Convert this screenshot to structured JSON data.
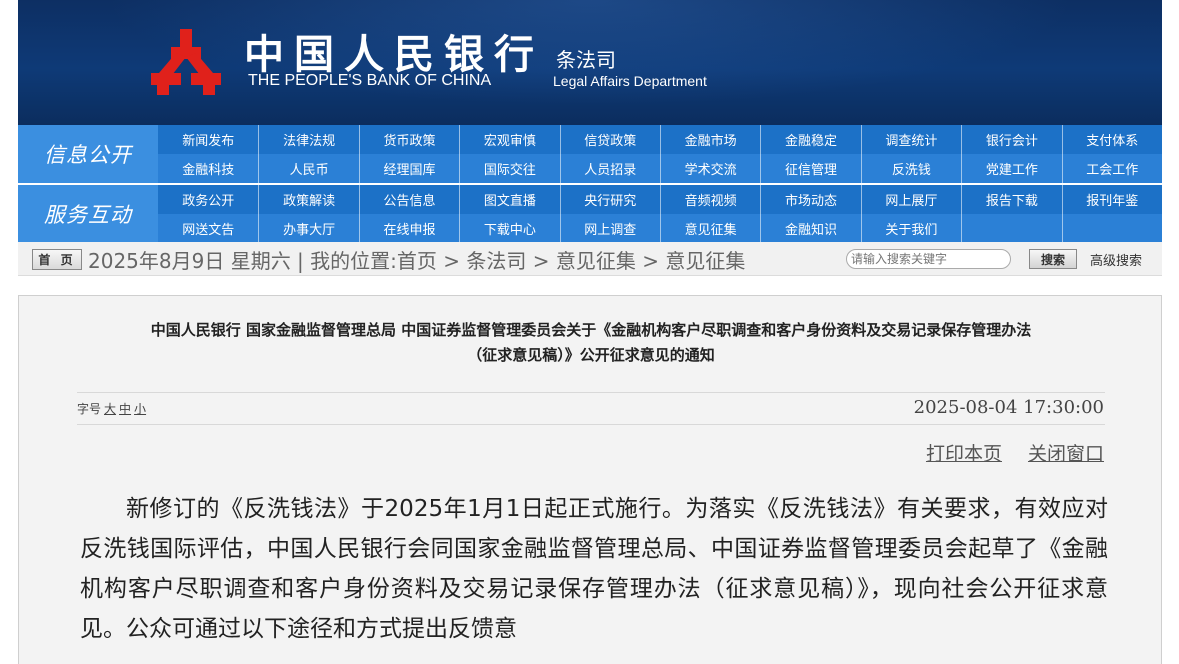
{
  "header": {
    "cn_name": "中国人民银行",
    "en_name": "THE PEOPLE'S BANK OF CHINA",
    "dept_cn": "条法司",
    "dept_en": "Legal Affairs Department",
    "logo_icon": "pboc-logo-icon",
    "logo_color": "#e0211b",
    "banner_color": "#0e3a77"
  },
  "nav": {
    "groups": [
      {
        "label": "信息公开",
        "rows": [
          [
            "新闻发布",
            "法律法规",
            "货币政策",
            "宏观审慎",
            "信贷政策",
            "金融市场",
            "金融稳定",
            "调查统计",
            "银行会计",
            "支付体系"
          ],
          [
            "金融科技",
            "人民币",
            "经理国库",
            "国际交往",
            "人员招录",
            "学术交流",
            "征信管理",
            "反洗钱",
            "党建工作",
            "工会工作"
          ]
        ]
      },
      {
        "label": "服务互动",
        "rows": [
          [
            "政务公开",
            "政策解读",
            "公告信息",
            "图文直播",
            "央行研究",
            "音频视频",
            "市场动态",
            "网上展厅",
            "报告下载",
            "报刊年鉴"
          ],
          [
            "网送文告",
            "办事大厅",
            "在线申报",
            "下载中心",
            "网上调查",
            "意见征集",
            "金融知识",
            "关于我们",
            "",
            ""
          ]
        ]
      }
    ],
    "color": "#1c71c7"
  },
  "infobar": {
    "home_label": "首 页",
    "breadcrumb": "2025年8月9日 星期六 | 我的位置:首页 > 条法司 > 意见征集 > 意见征集",
    "search_placeholder": "请输入搜索关键字",
    "search_button": "搜索",
    "advanced_search": "高级搜索"
  },
  "article": {
    "title_line1": "中国人民银行 国家金融监督管理总局 中国证券监督管理委员会关于《金融机构客户尽职调查和客户身份资料及交易记录保存管理办法",
    "title_line2": "（征求意见稿）》公开征求意见的通知",
    "font_size_label": "字号",
    "font_sizes": [
      "大",
      "中",
      "小"
    ],
    "date": "2025-08-04 17:30:00",
    "print_label": "打印本页",
    "close_label": "关闭窗口",
    "body": "新修订的《反洗钱法》于2025年1月1日起正式施行。为落实《反洗钱法》有关要求，有效应对反洗钱国际评估，中国人民银行会同国家金融监督管理总局、中国证券监督管理委员会起草了《金融机构客户尽职调查和客户身份资料及交易记录保存管理办法（征求意见稿）》，现向社会公开征求意见。公众可通过以下途径和方式提出反馈意"
  }
}
